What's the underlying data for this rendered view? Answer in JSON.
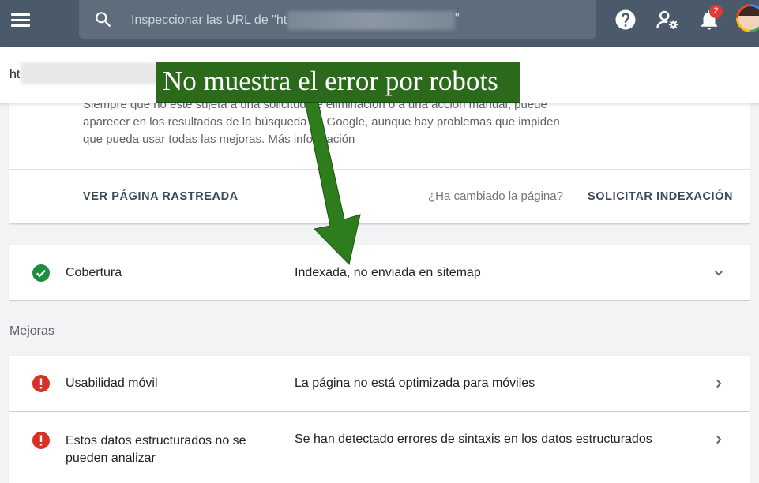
{
  "header": {
    "search_placeholder": "Inspeccionar las URL de \"ht",
    "search_placeholder_end": "\"",
    "notification_count": "2",
    "icons": [
      "menu-icon",
      "search-icon",
      "help-icon",
      "manage-users-icon",
      "notifications-icon",
      "avatar"
    ]
  },
  "url_bar": {
    "url_prefix": "ht"
  },
  "index_card": {
    "description": "Siempre que no esté sujeta a una solicitud de eliminación o a una acción manual, puede aparecer en los resultados de la búsqueda de Google, aunque hay problemas que impiden que pueda usar todas las mejoras.",
    "more_info": "Más información",
    "view_crawled": "VER PÁGINA RASTREADA",
    "changed_question": "¿Ha cambiado la página?",
    "request_indexing": "SOLICITAR INDEXACIÓN"
  },
  "coverage": {
    "label": "Cobertura",
    "value": "Indexada, no enviada en sitemap",
    "status_color": "#1e8e3e"
  },
  "enhancements": {
    "title": "Mejoras",
    "items": [
      {
        "label": "Usabilidad móvil",
        "value": "La página no está optimizada para móviles",
        "status_color": "#d93025"
      },
      {
        "label": "Estos datos estructurados no se pueden analizar",
        "value": "Se han detectado errores de sintaxis en los datos estructurados",
        "status_color": "#d93025"
      }
    ]
  },
  "annotation": {
    "text": "No muestra el error por robots",
    "color": "#2a6a1a"
  }
}
